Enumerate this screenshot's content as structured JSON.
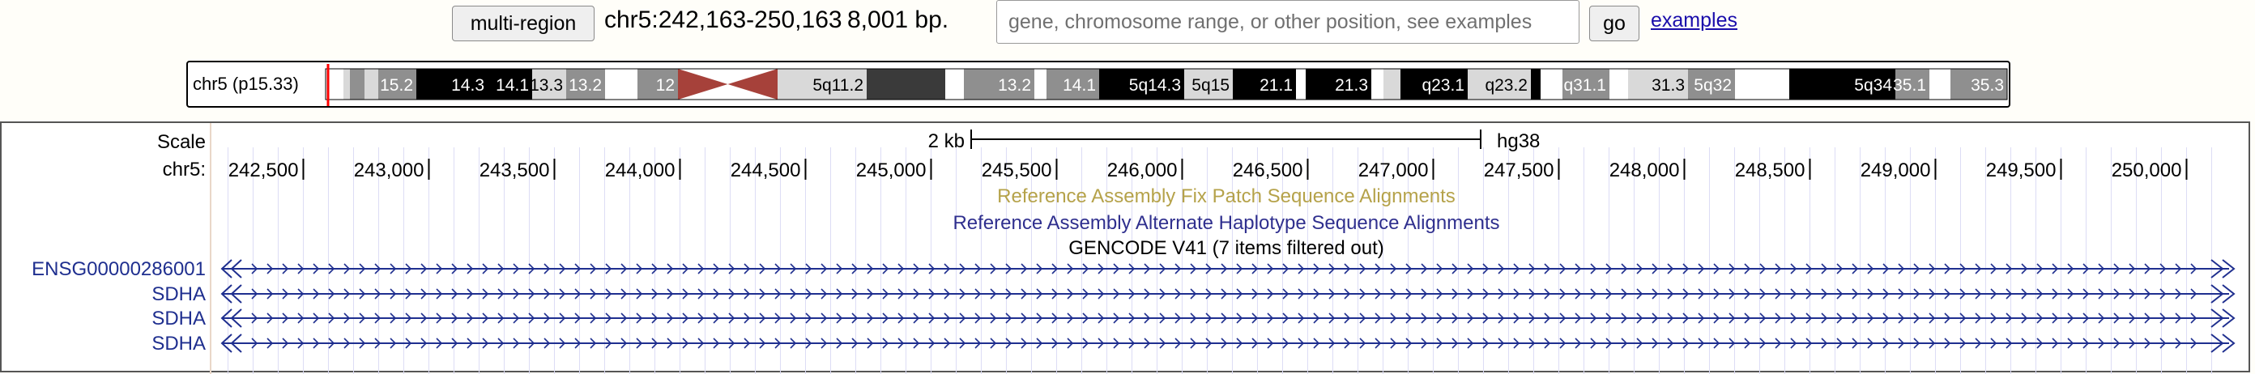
{
  "nav": {
    "multi_region_label": "multi-region",
    "position": "chr5:242,163-250,163",
    "size": "8,001 bp.",
    "search_placeholder": "gene, chromosome range, or other position, see examples",
    "go_label": "go",
    "examples_label": "examples"
  },
  "ideogram": {
    "label": "chr5 (p15.33)",
    "bands": [
      {
        "name": "",
        "color": "#ffffff"
      },
      {
        "name": "",
        "color": "#d9d9d9"
      },
      {
        "name": "",
        "color": "#909090"
      },
      {
        "name": "",
        "color": "#d9d9d9"
      },
      {
        "name": "15.2",
        "color": "#8f8f8f"
      },
      {
        "name": "14.3",
        "color": "#000000"
      },
      {
        "name": "14.1",
        "color": "#000000"
      },
      {
        "name": "13.3",
        "color": "#d9d9d9"
      },
      {
        "name": "13.2",
        "color": "#909090"
      },
      {
        "name": "",
        "color": "#ffffff"
      },
      {
        "name": "12",
        "color": "#8f8f8f"
      },
      {
        "name": "",
        "color": "#a6413a"
      },
      {
        "name": "5q11.2",
        "color": "#d9d9d9"
      },
      {
        "name": "",
        "color": "#3a3a3a"
      },
      {
        "name": "",
        "color": "#ffffff"
      },
      {
        "name": "",
        "color": "#8f8f8f"
      },
      {
        "name": "13.2",
        "color": "#8f8f8f"
      },
      {
        "name": "",
        "color": "#ffffff"
      },
      {
        "name": "14.1",
        "color": "#8f8f8f"
      },
      {
        "name": "",
        "color": "#000000"
      },
      {
        "name": "5q14.3",
        "color": "#000000"
      },
      {
        "name": "5q15",
        "color": "#d9d9d9"
      },
      {
        "name": "21.1",
        "color": "#000000"
      },
      {
        "name": "",
        "color": "#ffffff"
      },
      {
        "name": "21.3",
        "color": "#000000"
      },
      {
        "name": "",
        "color": "#ffffff"
      },
      {
        "name": "",
        "color": "#d9d9d9"
      },
      {
        "name": "q23.1",
        "color": "#000000"
      },
      {
        "name": "q23.2",
        "color": "#d9d9d9"
      },
      {
        "name": "",
        "color": "#000000"
      },
      {
        "name": "",
        "color": "#ffffff"
      },
      {
        "name": "q31.1",
        "color": "#8f8f8f"
      },
      {
        "name": "",
        "color": "#ffffff"
      },
      {
        "name": "31.3",
        "color": "#d9d9d9"
      },
      {
        "name": "5q32",
        "color": "#8f8f8f"
      },
      {
        "name": "",
        "color": "#ffffff"
      },
      {
        "name": "",
        "color": "#000000"
      },
      {
        "name": "5q34",
        "color": "#000000"
      },
      {
        "name": "35.1",
        "color": "#8f8f8f"
      },
      {
        "name": "",
        "color": "#ffffff"
      },
      {
        "name": "35.3",
        "color": "#8f8f8f"
      }
    ]
  },
  "tracks": {
    "scale_label": "Scale",
    "scale_bar_label": "2 kb",
    "assembly": "hg38",
    "chrom_label": "chr5:",
    "ticks": [
      "242,500",
      "243,000",
      "243,500",
      "244,000",
      "244,500",
      "245,000",
      "245,500",
      "246,000",
      "246,500",
      "247,000",
      "247,500",
      "248,000",
      "248,500",
      "249,000",
      "249,500",
      "250,000"
    ],
    "fix_patch_label": "Reference Assembly Fix Patch Sequence Alignments",
    "alt_haplotype_label": "Reference Assembly Alternate Haplotype Sequence Alignments",
    "gencode_label": "GENCODE V41 (7 items filtered out)",
    "genes": [
      "ENSG00000286001",
      "SDHA",
      "SDHA",
      "SDHA"
    ]
  },
  "colors": {
    "fix_patch": "#b5a24a",
    "alt_haplotype": "#2f2f8e",
    "gene": "#1f2f8f",
    "centromere": "#a6413a",
    "position_marker": "#ff0000"
  }
}
